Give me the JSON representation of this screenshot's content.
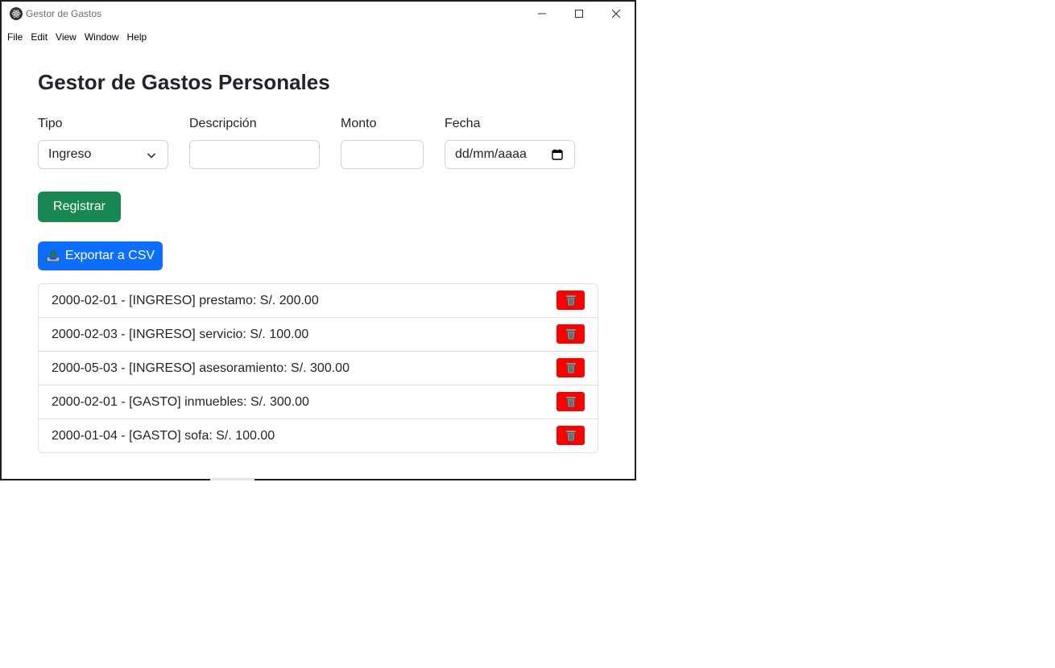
{
  "window": {
    "title": "Gestor de Gastos"
  },
  "menu": {
    "items": [
      "File",
      "Edit",
      "View",
      "Window",
      "Help"
    ]
  },
  "page": {
    "title": "Gestor de Gastos Personales"
  },
  "form": {
    "tipo_label": "Tipo",
    "tipo_value": "Ingreso",
    "descripcion_label": "Descripción",
    "descripcion_value": "",
    "monto_label": "Monto",
    "monto_value": "",
    "fecha_label": "Fecha",
    "fecha_placeholder": "dd/mm/aaaa",
    "register_label": "Registrar"
  },
  "export": {
    "label": "Exportar a CSV"
  },
  "transactions": [
    "2000-02-01 - [INGRESO] prestamo: S/. 200.00",
    "2000-02-03 - [INGRESO] servicio: S/. 100.00",
    "2000-05-03 - [INGRESO] asesoramiento: S/. 300.00",
    "2000-02-01 - [GASTO] inmuebles: S/. 300.00",
    "2000-01-04 - [GASTO] sofa: S/. 100.00"
  ],
  "colors": {
    "register": "#198754",
    "export": "#0d6efd",
    "delete": "#ff0000"
  },
  "icons": {
    "app": "electron-atom-icon",
    "export": "inbox-tray-icon",
    "delete": "trash-can-icon",
    "select": "chevron-down-icon",
    "date": "calendar-icon"
  }
}
